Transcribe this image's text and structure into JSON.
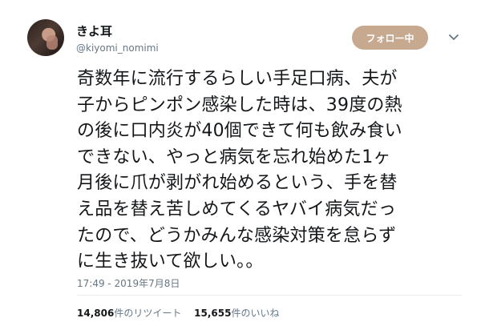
{
  "user": {
    "display_name": "きよ耳",
    "handle": "@kiyomi_nomimi"
  },
  "actions": {
    "follow_label": "フォロー中"
  },
  "tweet": {
    "lines": [
      "奇数年に流行するらしい手足口病、夫が",
      "子からピンポン感染した時は、39度の熱",
      "の後に口内炎が40個できて何も飲み食い",
      "できない、やっと病気を忘れ始めた1ヶ",
      "月後に爪が剥がれ始めるという、手を替",
      "え品を替え苦しめてくるヤバイ病気だっ",
      "たので、どうかみんな感染対策を怠らず",
      "に生き抜いて欲しい。。"
    ],
    "timestamp": "17:49 - 2019年7月8日"
  },
  "stats": {
    "retweets_count": "14,806",
    "retweets_label": "件のリツイート",
    "likes_count": "15,655",
    "likes_label": "件のいいね"
  },
  "icons": {
    "more": "chevron-down-icon"
  }
}
